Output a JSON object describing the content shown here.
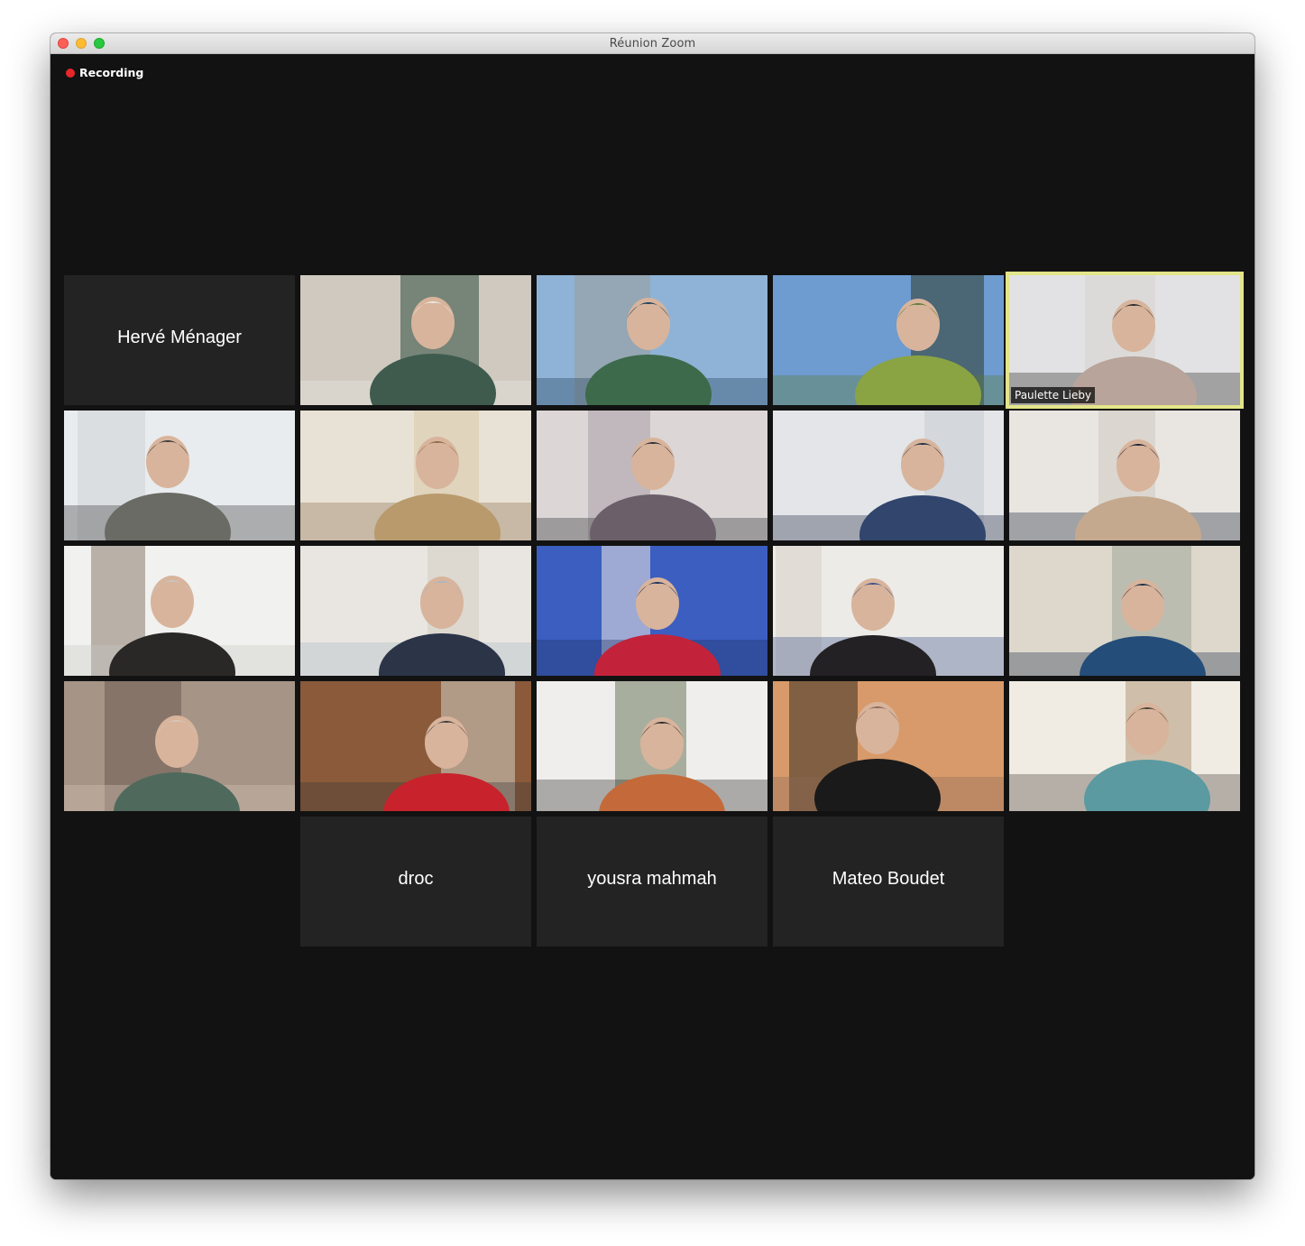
{
  "window": {
    "title": "Réunion Zoom"
  },
  "recording": {
    "label": "Recording",
    "color": "#e8262b"
  },
  "active_speaker_color": "#e3e58a",
  "participants": [
    {
      "name": "Hervé Ménager",
      "video": false
    },
    {
      "name": "",
      "video": true,
      "palette": [
        "#cfc9c0",
        "#3e5b4e",
        "#ece8e1",
        "#2f4a3d"
      ]
    },
    {
      "name": "",
      "video": true,
      "palette": [
        "#8fb3d6",
        "#3d6a4a",
        "#1e3f5a",
        "#9a9a9a"
      ]
    },
    {
      "name": "",
      "video": true,
      "palette": [
        "#6e9bd0",
        "#8aa443",
        "#5f7a35",
        "#2f3a2a"
      ]
    },
    {
      "name": "Paulette Lieby",
      "video": true,
      "active": true,
      "palette": [
        "#e2e2e4",
        "#b8a49a",
        "#2a2a2a",
        "#d7d3cf"
      ]
    },
    {
      "name": "",
      "video": true,
      "palette": [
        "#e9ecee",
        "#6b6b65",
        "#3a3a3a",
        "#cfd3d6"
      ]
    },
    {
      "name": "",
      "video": true,
      "palette": [
        "#e8e2d6",
        "#b89a6c",
        "#8a6d4a",
        "#d9c9aa"
      ]
    },
    {
      "name": "",
      "video": true,
      "palette": [
        "#dcd6d6",
        "#6b5f6a",
        "#2b2d33",
        "#a9a1a8"
      ]
    },
    {
      "name": "",
      "video": true,
      "palette": [
        "#e3e5e8",
        "#31456d",
        "#1f2b45",
        "#c9ccd2"
      ]
    },
    {
      "name": "",
      "video": true,
      "palette": [
        "#e9e6e2",
        "#c4a98e",
        "#1d2233",
        "#cfc8c0"
      ]
    },
    {
      "name": "",
      "video": true,
      "palette": [
        "#f1f1ef",
        "#2a2727",
        "#c7c7c4",
        "#8b7b6d"
      ]
    },
    {
      "name": "",
      "video": true,
      "palette": [
        "#e9e6e1",
        "#2c3448",
        "#a8b6c4",
        "#d3cdc4"
      ]
    },
    {
      "name": "",
      "video": true,
      "palette": [
        "#3b5ec0",
        "#c3233a",
        "#1d2f5e",
        "#f0e8e4"
      ]
    },
    {
      "name": "",
      "video": true,
      "palette": [
        "#ecebe7",
        "#232123",
        "#3c4f8c",
        "#d8d2c8"
      ]
    },
    {
      "name": "",
      "video": true,
      "palette": [
        "#ded7cc",
        "#244d79",
        "#1f2f45",
        "#9fa79a"
      ]
    },
    {
      "name": "",
      "video": true,
      "palette": [
        "#a69487",
        "#4f6a5c",
        "#d6c8b8",
        "#6c5a50"
      ]
    },
    {
      "name": "",
      "video": true,
      "palette": [
        "#8a5a3a",
        "#c8222c",
        "#3a3a3a",
        "#d1cfc4"
      ]
    },
    {
      "name": "",
      "video": true,
      "palette": [
        "#f0eeec",
        "#c46a3a",
        "#2a2a2a",
        "#6d7a5c"
      ]
    },
    {
      "name": "",
      "video": true,
      "palette": [
        "#d89a6a",
        "#1a1a1a",
        "#8a6a5a",
        "#3a3020"
      ]
    },
    {
      "name": "",
      "video": true,
      "palette": [
        "#f0ece4",
        "#5a9aa0",
        "#4a4038",
        "#b49a7a"
      ]
    },
    {
      "name": "droc",
      "video": false
    },
    {
      "name": "yousra mahmah",
      "video": false
    },
    {
      "name": "Mateo Boudet",
      "video": false
    }
  ]
}
